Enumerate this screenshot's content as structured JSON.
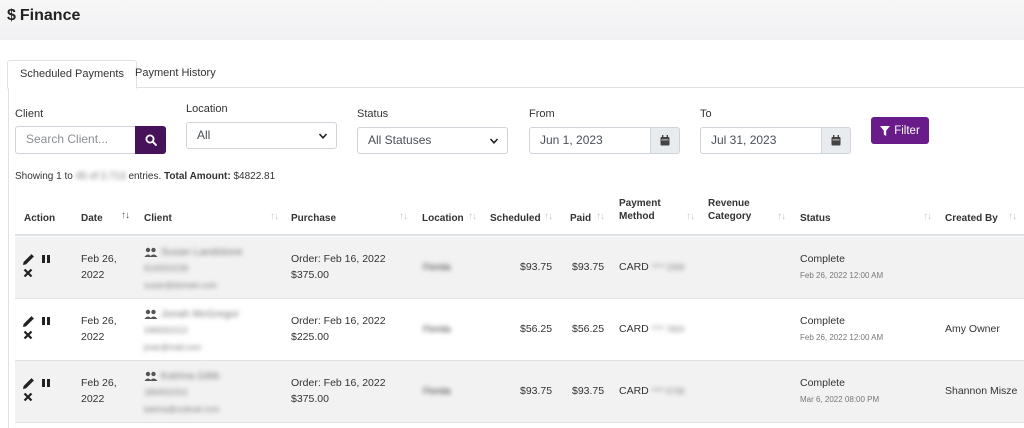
{
  "page": {
    "title_symbol": "$",
    "title": "Finance"
  },
  "tabs": [
    {
      "label": "Scheduled Payments",
      "active": true
    },
    {
      "label": "Payment History",
      "active": false
    }
  ],
  "filters": {
    "client_label": "Client",
    "client_placeholder": "Search Client...",
    "location_label": "Location",
    "location_value": "All",
    "status_label": "Status",
    "status_value": "All Statuses",
    "from_label": "From",
    "from_value": "Jun 1, 2023",
    "to_label": "To",
    "to_value": "Jul 31, 2023",
    "filter_button": "Filter"
  },
  "summary": {
    "showing_prefix": "Showing 1 to",
    "showing_blurred": "45 of 2,713",
    "showing_suffix": "entries.",
    "total_label": "Total Amount:",
    "total_value": "$4822.81"
  },
  "table": {
    "columns": {
      "action": "Action",
      "date": "Date",
      "client": "Client",
      "purchase": "Purchase",
      "location": "Location",
      "scheduled": "Scheduled",
      "paid": "Paid",
      "payment_method_1": "Payment",
      "payment_method_2": "Method",
      "revenue_category_1": "Revenue",
      "revenue_category_2": "Category",
      "status": "Status",
      "created_by": "Created By"
    },
    "rows": [
      {
        "date_1": "Feb 26,",
        "date_2": "2022",
        "client_name": "Susan Landstone",
        "client_phone": "6145552230",
        "client_email": "susan@domain.com",
        "purchase_1": "Order: Feb 16, 2022",
        "purchase_2": "$375.00",
        "location": "Florida",
        "scheduled": "$93.75",
        "paid": "$93.75",
        "method": "CARD",
        "card_masked": "**** 2309",
        "status": "Complete",
        "status_time": "Feb 26, 2022 12:00 AM",
        "created_by": ""
      },
      {
        "date_1": "Feb 26,",
        "date_2": "2022",
        "client_name": "Jonah McGregor",
        "client_phone": "2465552112",
        "client_email": "jmac@mail.com",
        "purchase_1": "Order: Feb 16, 2022",
        "purchase_2": "$225.00",
        "location": "Florida",
        "scheduled": "$56.25",
        "paid": "$56.25",
        "method": "CARD",
        "card_masked": "**** 7824",
        "status": "Complete",
        "status_time": "Feb 26, 2022 12:00 AM",
        "created_by": "Amy Owner"
      },
      {
        "date_1": "Feb 26,",
        "date_2": "2022",
        "client_name": "Katrina Gibb",
        "client_phone": "1864552311",
        "client_email": "katrina@outlook.com",
        "purchase_1": "Order: Feb 16, 2022",
        "purchase_2": "$375.00",
        "location": "Florida",
        "scheduled": "$93.75",
        "paid": "$93.75",
        "method": "CARD",
        "card_masked": "**** 5739",
        "status": "Complete",
        "status_time": "Mar 6, 2022 08:00 PM",
        "created_by": "Shannon Misze"
      }
    ]
  },
  "colors": {
    "primary": "#46135b",
    "filter_button": "#6a1b8a",
    "row_stripe": "#f2f2f2"
  },
  "icons": [
    "search-icon",
    "calendar-icon",
    "filter-icon",
    "edit-icon",
    "pause-icon",
    "delete-icon",
    "users-icon",
    "sort-icon",
    "chevron-down-icon"
  ]
}
